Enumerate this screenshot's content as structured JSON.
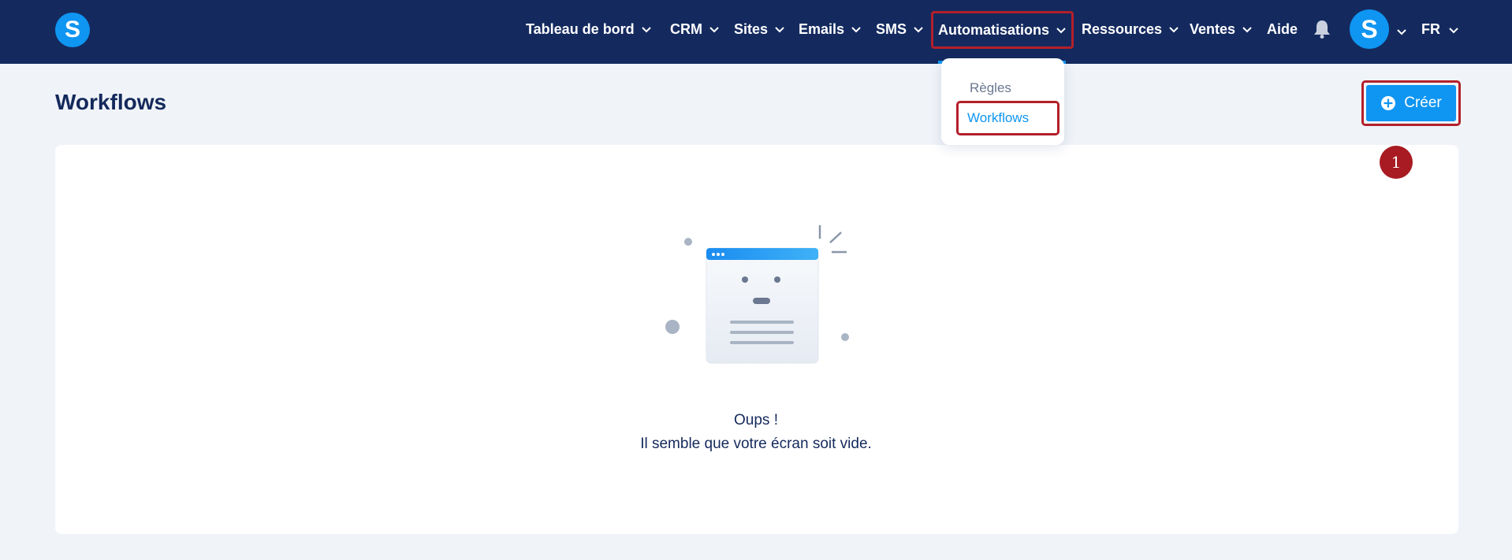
{
  "nav": {
    "logo_letter": "S",
    "items": [
      {
        "label": "Tableau de bord"
      },
      {
        "label": "CRM"
      },
      {
        "label": "Sites"
      },
      {
        "label": "Emails"
      },
      {
        "label": "SMS"
      },
      {
        "label": "Automatisations",
        "active": true
      },
      {
        "label": "Ressources"
      },
      {
        "label": "Ventes"
      },
      {
        "label": "Aide"
      }
    ],
    "notification_icon": "bell-icon",
    "avatar_letter": "S",
    "language": "FR"
  },
  "dropdown": {
    "items": [
      {
        "label": "Règles"
      },
      {
        "label": "Workflows",
        "highlighted": true
      }
    ]
  },
  "page": {
    "title": "Workflows",
    "create_label": "Créer",
    "create_icon": "plus-circle-icon",
    "step_badge": "1"
  },
  "empty_state": {
    "title": "Oups !",
    "message": "Il semble que votre écran soit vide."
  },
  "colors": {
    "navbar": "#142a5f",
    "accent": "#0f95f2",
    "highlight_border": "#b3202a",
    "background": "#f0f3f8"
  }
}
